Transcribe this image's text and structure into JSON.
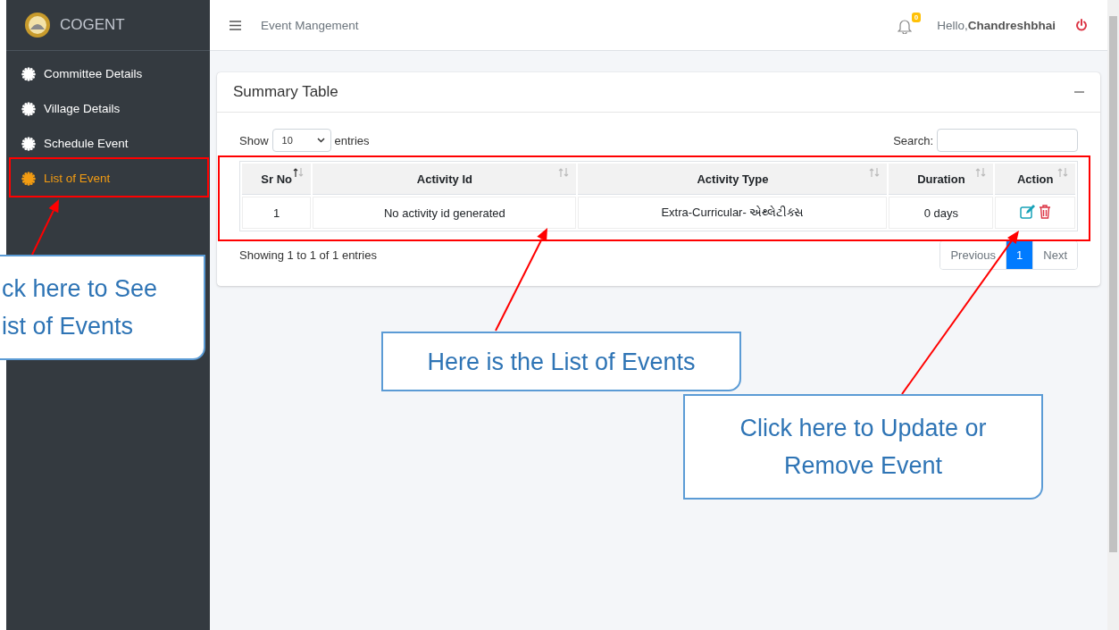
{
  "sidebar": {
    "brand": "COGENT",
    "items": [
      {
        "label": "Committee Details",
        "selected": false
      },
      {
        "label": "Village Details",
        "selected": false
      },
      {
        "label": "Schedule Event",
        "selected": false
      },
      {
        "label": "List of Event",
        "selected": true
      }
    ]
  },
  "header": {
    "title": "Event Mangement",
    "notification_count": "0",
    "greeting": "Hello,",
    "user": "Chandreshbhai"
  },
  "card": {
    "title": "Summary Table",
    "length_before": "Show",
    "length_value": "10",
    "length_after": "entries",
    "search_label": "Search:",
    "columns": [
      {
        "label": "Sr No",
        "sorted": true
      },
      {
        "label": "Activity Id",
        "sorted": false
      },
      {
        "label": "Activity Type",
        "sorted": false
      },
      {
        "label": "Duration",
        "sorted": false
      },
      {
        "label": "Action",
        "sorted": false
      }
    ],
    "rows": [
      {
        "cells": [
          "1",
          "No activity id generated",
          "Extra-Curricular- એથ્લેટીક્સ",
          "0 days"
        ]
      }
    ],
    "info": "Showing 1 to 1 of 1 entries",
    "pagination": [
      {
        "label": "Previous",
        "selected": false
      },
      {
        "label": "1",
        "selected": true
      },
      {
        "label": "Next",
        "selected": false
      }
    ]
  },
  "callouts": [
    {
      "text": "ck here to See\nist of Events"
    },
    {
      "text": "Here is the List of Events"
    },
    {
      "text": "Click here to Update or\nRemove Event"
    }
  ]
}
